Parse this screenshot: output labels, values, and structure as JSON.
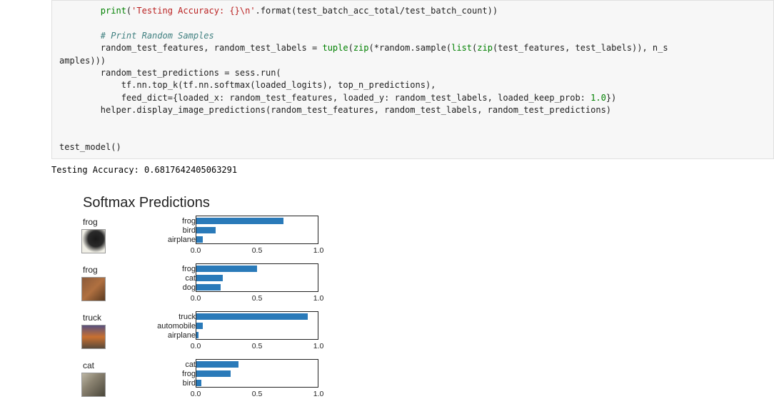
{
  "code_lines": [
    {
      "indent": 8,
      "segs": [
        {
          "t": "print",
          "c": "bi"
        },
        {
          "t": "("
        },
        {
          "t": "'Testing Accuracy: {}\\n'",
          "c": "str"
        },
        {
          "t": ".format(test_batch_acc_total"
        },
        {
          "t": "/"
        },
        {
          "t": "test_batch_count))"
        }
      ]
    },
    {
      "indent": 0,
      "segs": [
        {
          "t": ""
        }
      ]
    },
    {
      "indent": 8,
      "segs": [
        {
          "t": "# Print Random Samples",
          "c": "cmt"
        }
      ]
    },
    {
      "indent": 8,
      "segs": [
        {
          "t": "random_test_features, random_test_labels "
        },
        {
          "t": "="
        },
        {
          "t": " "
        },
        {
          "t": "tuple",
          "c": "bi"
        },
        {
          "t": "("
        },
        {
          "t": "zip",
          "c": "bi"
        },
        {
          "t": "("
        },
        {
          "t": "*"
        },
        {
          "t": "random.sample("
        },
        {
          "t": "list",
          "c": "bi"
        },
        {
          "t": "("
        },
        {
          "t": "zip",
          "c": "bi"
        },
        {
          "t": "(test_features, test_labels)), n_s"
        }
      ]
    },
    {
      "indent": 0,
      "segs": [
        {
          "t": "amples)))"
        }
      ]
    },
    {
      "indent": 8,
      "segs": [
        {
          "t": "random_test_predictions "
        },
        {
          "t": "="
        },
        {
          "t": " sess.run("
        }
      ]
    },
    {
      "indent": 12,
      "segs": [
        {
          "t": "tf.nn.top_k(tf.nn.softmax(loaded_logits), top_n_predictions),"
        }
      ]
    },
    {
      "indent": 12,
      "segs": [
        {
          "t": "feed_dict"
        },
        {
          "t": "="
        },
        {
          "t": "{loaded_x: random_test_features, loaded_y: random_test_labels, loaded_keep_prob: "
        },
        {
          "t": "1.0",
          "c": "num"
        },
        {
          "t": "})"
        }
      ]
    },
    {
      "indent": 8,
      "segs": [
        {
          "t": "helper.display_image_predictions(random_test_features, random_test_labels, random_test_predictions)"
        }
      ]
    },
    {
      "indent": 0,
      "segs": [
        {
          "t": ""
        }
      ]
    },
    {
      "indent": 0,
      "segs": [
        {
          "t": ""
        }
      ]
    },
    {
      "indent": 0,
      "segs": [
        {
          "t": "test_model()"
        }
      ]
    }
  ],
  "output_text": "Testing Accuracy: 0.6817642405063291",
  "chart_title": "Softmax Predictions",
  "xticks": [
    "0.0",
    "0.5",
    "1.0"
  ],
  "rows": [
    {
      "true_label": "frog",
      "thumb_class": "thumb-frog1",
      "preds": [
        {
          "label": "frog",
          "p": 0.72
        },
        {
          "label": "bird",
          "p": 0.16
        },
        {
          "label": "airplane",
          "p": 0.05
        }
      ]
    },
    {
      "true_label": "frog",
      "thumb_class": "thumb-frog2",
      "preds": [
        {
          "label": "frog",
          "p": 0.5
        },
        {
          "label": "cat",
          "p": 0.22
        },
        {
          "label": "dog",
          "p": 0.2
        }
      ]
    },
    {
      "true_label": "truck",
      "thumb_class": "thumb-truck",
      "preds": [
        {
          "label": "truck",
          "p": 0.92
        },
        {
          "label": "automobile",
          "p": 0.05
        },
        {
          "label": "airplane",
          "p": 0.02
        }
      ]
    },
    {
      "true_label": "cat",
      "thumb_class": "thumb-cat",
      "preds": [
        {
          "label": "cat",
          "p": 0.35
        },
        {
          "label": "frog",
          "p": 0.28
        },
        {
          "label": "bird",
          "p": 0.04
        }
      ]
    }
  ],
  "chart_data": [
    {
      "type": "bar",
      "title": "frog",
      "categories": [
        "frog",
        "bird",
        "airplane"
      ],
      "values": [
        0.72,
        0.16,
        0.05
      ],
      "xlim": [
        0.0,
        1.0
      ],
      "xticks": [
        0.0,
        0.5,
        1.0
      ]
    },
    {
      "type": "bar",
      "title": "frog",
      "categories": [
        "frog",
        "cat",
        "dog"
      ],
      "values": [
        0.5,
        0.22,
        0.2
      ],
      "xlim": [
        0.0,
        1.0
      ],
      "xticks": [
        0.0,
        0.5,
        1.0
      ]
    },
    {
      "type": "bar",
      "title": "truck",
      "categories": [
        "truck",
        "automobile",
        "airplane"
      ],
      "values": [
        0.92,
        0.05,
        0.02
      ],
      "xlim": [
        0.0,
        1.0
      ],
      "xticks": [
        0.0,
        0.5,
        1.0
      ]
    },
    {
      "type": "bar",
      "title": "cat",
      "categories": [
        "cat",
        "frog",
        "bird"
      ],
      "values": [
        0.35,
        0.28,
        0.04
      ],
      "xlim": [
        0.0,
        1.0
      ],
      "xticks": [
        0.0,
        0.5,
        1.0
      ]
    }
  ]
}
